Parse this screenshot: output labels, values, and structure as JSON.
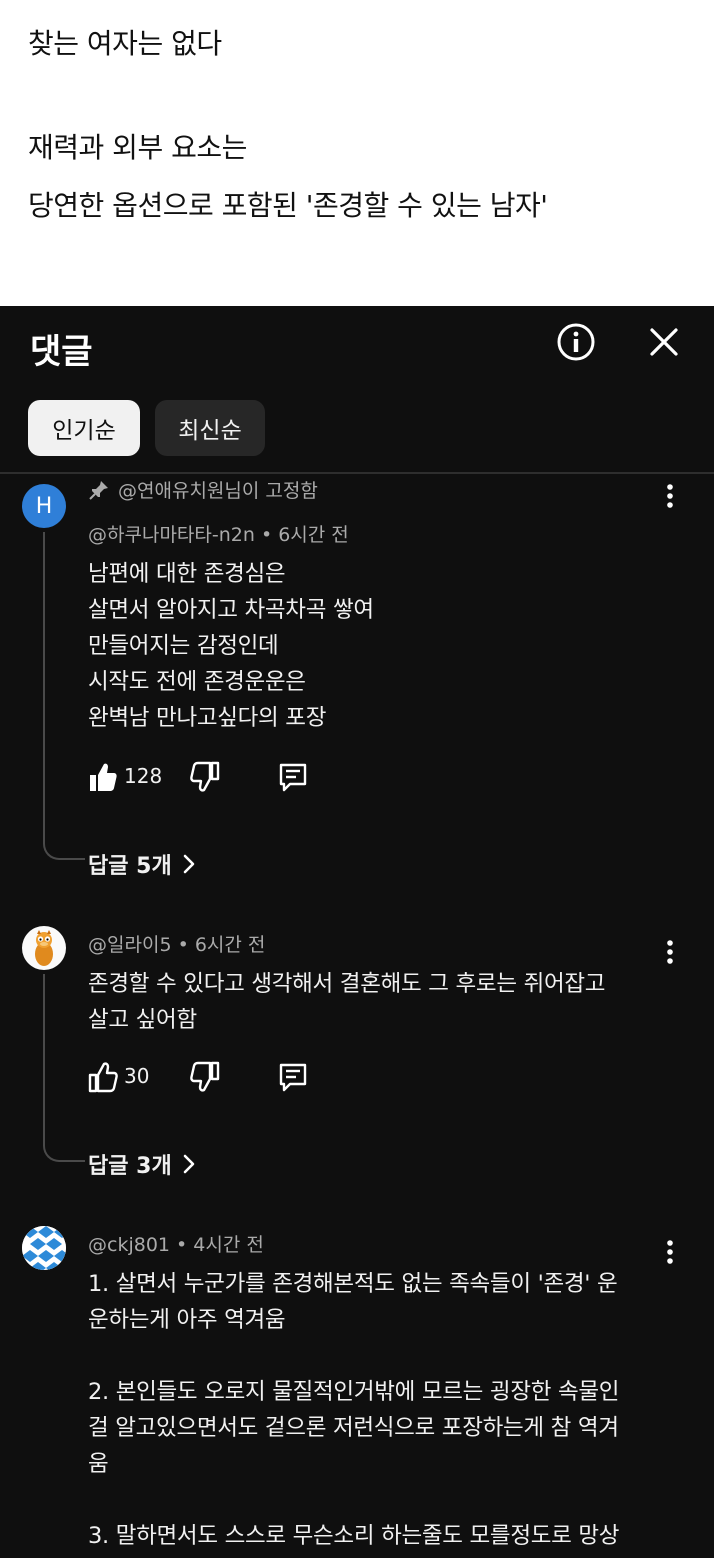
{
  "post": {
    "lines": [
      "찾는 여자는 없다",
      "재력과 외부 요소는",
      "당연한 옵션으로 포함된 '존경할 수 있는 남자'"
    ]
  },
  "panel": {
    "title": "댓글",
    "sort_chips": [
      "인기순",
      "최신순"
    ]
  },
  "comments": [
    {
      "avatar_letter": "H",
      "pinned_label": "@연애유치원님이 고정함",
      "author": "@하쿠나마타타-n2n",
      "time": "6시간 전",
      "lines": [
        "남편에 대한 존경심은",
        "살면서 알아지고 차곡차곡 쌓여",
        "만들어지는 감정인데",
        "시작도 전에 존경운운은",
        "완벽남 만나고싶다의 포장"
      ],
      "likes": "128",
      "replies": "답글 5개"
    },
    {
      "author": "@일라이5",
      "time": "6시간 전",
      "lines": [
        "존경할 수 있다고 생각해서 결혼해도 그 후로는 쥐어잡고",
        "살고 싶어함"
      ],
      "likes": "30",
      "replies": "답글 3개"
    },
    {
      "author": "@ckj801",
      "time": "4시간 전",
      "lines": [
        "1. 살면서 누군가를 존경해본적도 없는 족속들이 '존경' 운",
        "운하는게 아주 역겨움",
        "2. 본인들도 오로지 물질적인거밖에 모르는 굉장한 속물인",
        "걸 알고있으면서도 겉으론 저런식으로 포장하는게 참 역겨",
        "움",
        "3. 말하면서도 스스로 무슨소리 하는줄도 모를정도로 망상"
      ]
    }
  ],
  "icons": {
    "info": "info-circle-icon",
    "close": "close-icon",
    "pin": "pin-icon",
    "like": "thumbs-up-icon",
    "dislike": "thumbs-down-icon",
    "reply": "comment-icon",
    "more": "more-vertical-icon",
    "chevron": "chevron-right-icon"
  }
}
